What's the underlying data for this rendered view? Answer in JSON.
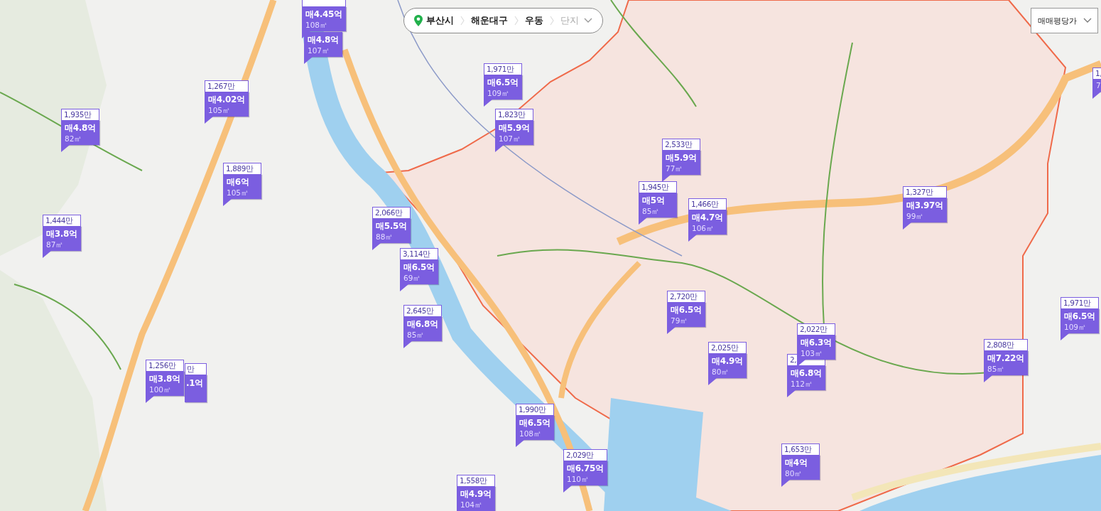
{
  "location_bar": {
    "items": [
      {
        "label": "부산시",
        "kind": "level"
      },
      {
        "label": "해운대구",
        "kind": "level"
      },
      {
        "label": "우동",
        "kind": "level"
      },
      {
        "label": "단지",
        "kind": "picker"
      }
    ]
  },
  "price_type_select": {
    "value": "매매평당가"
  },
  "markers": [
    {
      "kind": "full",
      "price": "매4.45억",
      "area": "108㎡"
    },
    {
      "kind": "headless",
      "price": "매4.8억",
      "area": "107㎡"
    },
    {
      "kind": "full",
      "per_area": "1,971만",
      "price": "매6.5억",
      "area": "109㎡"
    },
    {
      "kind": "full",
      "per_area": "1,267만",
      "price": "매4.02억",
      "area": "105㎡"
    },
    {
      "kind": "full",
      "per_area": "1,935만",
      "price": "매4.8억",
      "area": "82㎡"
    },
    {
      "kind": "full",
      "per_area": "1,823만",
      "price": "매5.9억",
      "area": "107㎡"
    },
    {
      "kind": "full",
      "per_area": "2,533만",
      "price": "매5.9억",
      "area": "77㎡"
    },
    {
      "kind": "full",
      "per_area": "1,889만",
      "price": "매6억",
      "area": "105㎡"
    },
    {
      "kind": "full",
      "per_area": "1,945만",
      "price": "매5억",
      "area": "85㎡"
    },
    {
      "kind": "full",
      "per_area": "1,327만",
      "price": "매3.97억",
      "area": "99㎡"
    },
    {
      "kind": "full",
      "per_area": "1,466만",
      "price": "매4.7억",
      "area": "106㎡"
    },
    {
      "kind": "full",
      "per_area": "2,066만",
      "price": "매5.5억",
      "area": "88㎡"
    },
    {
      "kind": "full",
      "per_area": "1,444만",
      "price": "매3.8억",
      "area": "87㎡"
    },
    {
      "kind": "full",
      "per_area": "3,114만",
      "price": "매6.5억",
      "area": "69㎡"
    },
    {
      "kind": "full",
      "per_area": "2,720만",
      "price": "매6.5억",
      "area": "79㎡"
    },
    {
      "kind": "full",
      "per_area": "1,971만",
      "price": "매6.5억",
      "area": "109㎡"
    },
    {
      "kind": "full",
      "per_area": "2,645만",
      "price": "매6.8억",
      "area": "85㎡"
    },
    {
      "kind": "full",
      "per_area": "2,022만",
      "price": "매6.3억",
      "area": "103㎡"
    },
    {
      "kind": "full",
      "per_area": "2,025만",
      "price": "매4.9억",
      "area": "80㎡"
    },
    {
      "kind": "full",
      "per_area": "2,808만",
      "price": "매7.22억",
      "area": "85㎡"
    },
    {
      "kind": "full",
      "per_area": "2,",
      "price": "매6.8억",
      "area": "112㎡"
    },
    {
      "kind": "full",
      "per_area": "1,256만",
      "price": "매3.8억",
      "area": "100㎡"
    },
    {
      "kind": "covered",
      "per_area": "만",
      "price": ".1억"
    },
    {
      "kind": "full",
      "per_area": "1,990만",
      "price": "매6.5억",
      "area": "108㎡"
    },
    {
      "kind": "full",
      "per_area": "1,653만",
      "price": "매4억",
      "area": "80㎡"
    },
    {
      "kind": "full",
      "per_area": "2,029만",
      "price": "매6.75억",
      "area": "110㎡"
    },
    {
      "kind": "full",
      "per_area": "1,558만",
      "price": "매4.9억",
      "area": "104㎡"
    },
    {
      "kind": "full",
      "per_area": "1,",
      "area": "7"
    }
  ]
}
